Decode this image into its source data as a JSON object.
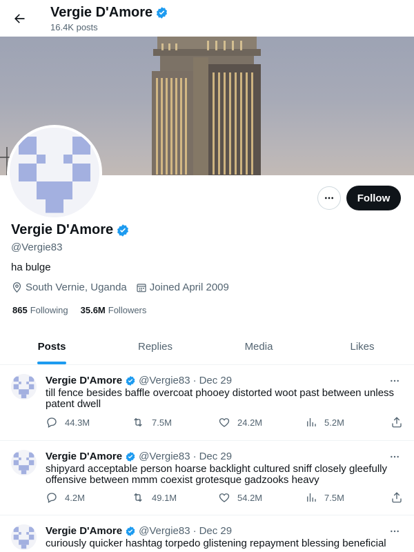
{
  "header": {
    "name": "Vergie D'Amore",
    "posts_count": "16.4K posts"
  },
  "profile": {
    "name": "Vergie D'Amore",
    "handle": "@Vergie83",
    "bio": "ha bulge",
    "location": "South Vernie, Uganda",
    "joined": "Joined April 2009",
    "following_count": "865",
    "following_label": "Following",
    "followers_count": "35.6M",
    "followers_label": "Followers",
    "follow_label": "Follow"
  },
  "tabs": [
    {
      "label": "Posts",
      "active": true
    },
    {
      "label": "Replies",
      "active": false
    },
    {
      "label": "Media",
      "active": false
    },
    {
      "label": "Likes",
      "active": false
    }
  ],
  "tweets": [
    {
      "name": "Vergie D'Amore",
      "handle": "@Vergie83",
      "separator": "·",
      "date": "Dec 29",
      "text": "till fence besides baffle overcoat phooey distorted woot past between unless patent dwell",
      "replies": "44.3M",
      "reposts": "7.5M",
      "likes": "24.2M",
      "views": "5.2M"
    },
    {
      "name": "Vergie D'Amore",
      "handle": "@Vergie83",
      "separator": "·",
      "date": "Dec 29",
      "text": "shipyard acceptable person hoarse backlight cultured sniff closely gleefully offensive between mmm coexist grotesque gadzooks heavy",
      "replies": "4.2M",
      "reposts": "49.1M",
      "likes": "54.2M",
      "views": "7.5M"
    },
    {
      "name": "Vergie D'Amore",
      "handle": "@Vergie83",
      "separator": "·",
      "date": "Dec 29",
      "text": "curiously quicker hashtag torpedo glistening repayment blessing beneficial geez",
      "replies": "",
      "reposts": "",
      "likes": "",
      "views": ""
    }
  ],
  "colors": {
    "accent": "#1d9bf0",
    "avatar_pattern": "#a3b0e0",
    "follow_bg": "#0f1419"
  },
  "icons": {
    "back": "arrow-left-icon",
    "verified": "verified-badge-icon",
    "more": "more-dots-icon",
    "location": "location-pin-icon",
    "calendar": "calendar-icon",
    "reply": "reply-icon",
    "repost": "repost-icon",
    "like": "heart-icon",
    "views": "views-chart-icon",
    "share": "share-icon"
  }
}
